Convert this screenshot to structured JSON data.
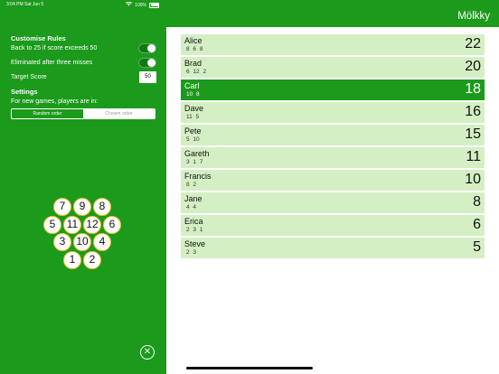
{
  "status": {
    "time_date": "3:04 PM  Sat Jun 5",
    "battery": "100%"
  },
  "settings_panel": {
    "customise_title": "Customise Rules",
    "rules": [
      {
        "label": "Back to 25 if score exceeds 50",
        "enabled": true
      },
      {
        "label": "Eliminated after three misses",
        "enabled": true
      }
    ],
    "target_score_label": "Target Score",
    "target_score_value": "50",
    "settings_title": "Settings",
    "order_prompt": "For new games, players are in:",
    "order_options": [
      "Random order",
      "Chosen order"
    ],
    "order_selected": "Random order",
    "pins": [
      "7",
      "9",
      "8",
      "5",
      "11",
      "12",
      "6",
      "3",
      "10",
      "4",
      "1",
      "2"
    ],
    "close_icon": "close-circle-icon"
  },
  "header": {
    "title": "Mölkky"
  },
  "players": [
    {
      "name": "Alice",
      "scores": "8  6  8",
      "total": "22",
      "active": false
    },
    {
      "name": "Brad",
      "scores": "6  12  2",
      "total": "20",
      "active": false
    },
    {
      "name": "Carl",
      "scores": "10  8",
      "total": "18",
      "active": true
    },
    {
      "name": "Dave",
      "scores": "11  5",
      "total": "16",
      "active": false
    },
    {
      "name": "Pete",
      "scores": "5  10",
      "total": "15",
      "active": false
    },
    {
      "name": "Gareth",
      "scores": "3  1  7",
      "total": "11",
      "active": false
    },
    {
      "name": "Francis",
      "scores": "8  2",
      "total": "10",
      "active": false
    },
    {
      "name": "Jane",
      "scores": "4  4",
      "total": "8",
      "active": false
    },
    {
      "name": "Erica",
      "scores": "2  3  1",
      "total": "6",
      "active": false
    },
    {
      "name": "Steve",
      "scores": "2  3",
      "total": "5",
      "active": false
    }
  ],
  "colors": {
    "accent": "#1c9a1c",
    "row": "#d4efc4",
    "pin_border": "#f0c030"
  }
}
